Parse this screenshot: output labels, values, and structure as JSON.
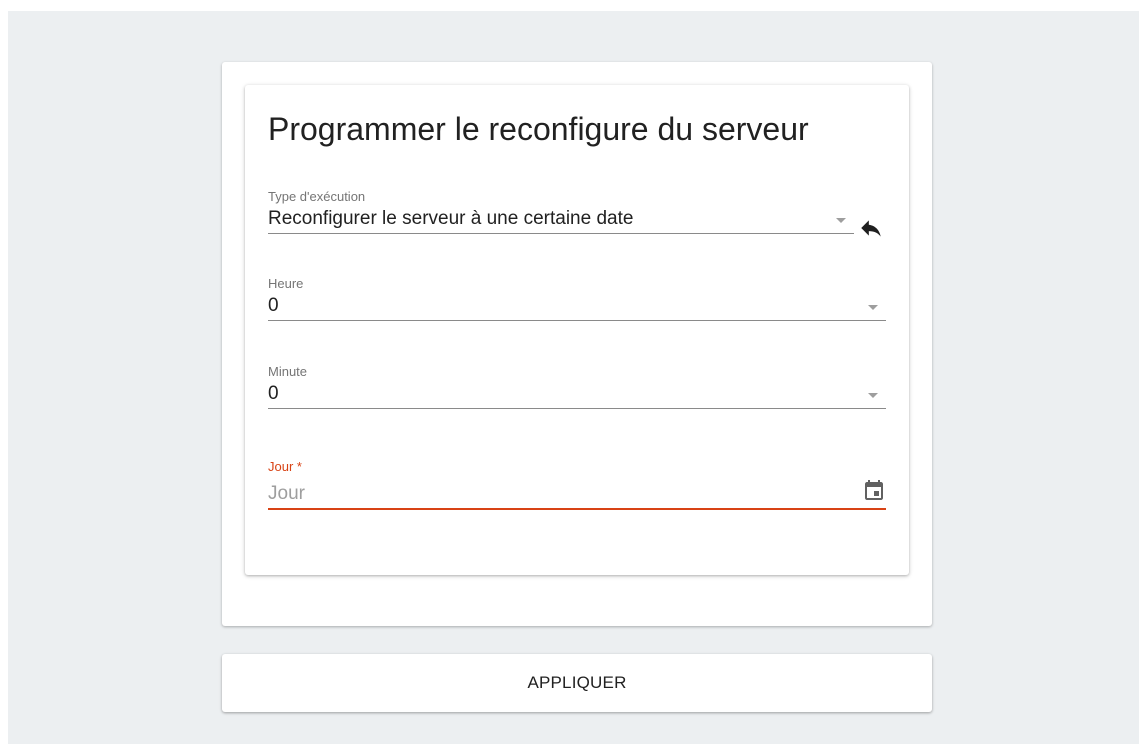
{
  "card": {
    "title": "Programmer le reconfigure du serveur"
  },
  "fields": {
    "type": {
      "label": "Type d'exécution",
      "value": "Reconfigurer le serveur à une certaine date"
    },
    "heure": {
      "label": "Heure",
      "value": "0"
    },
    "minute": {
      "label": "Minute",
      "value": "0"
    },
    "jour": {
      "label": "Jour *",
      "placeholder": "Jour",
      "error_color": "#d84315"
    }
  },
  "actions": {
    "apply_label": "APPLIQUER"
  },
  "icons": {
    "reset": "undo-arrow-icon",
    "calendar": "calendar-icon",
    "dropdown": "chevron-down-icon"
  },
  "colors": {
    "background": "#eceff1",
    "error": "#d84315"
  }
}
